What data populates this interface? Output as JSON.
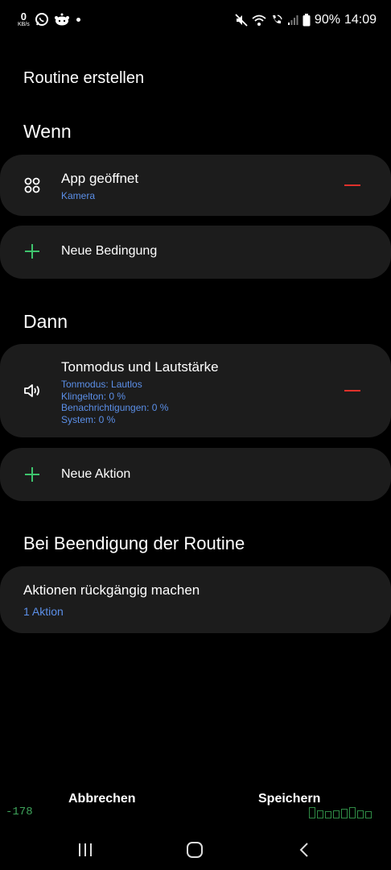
{
  "status_bar": {
    "net_speed_value": "0",
    "net_speed_unit": "KB/s",
    "battery": "90%",
    "time": "14:09"
  },
  "page_title": "Routine erstellen",
  "when": {
    "title": "Wenn",
    "condition": {
      "title": "App geöffnet",
      "subtitle": "Kamera",
      "icon": "apps-icon"
    },
    "add_label": "Neue Bedingung"
  },
  "then": {
    "title": "Dann",
    "action": {
      "title": "Tonmodus und Lautstärke",
      "details": [
        "Tonmodus: Lautlos",
        "Klingelton: 0 %",
        "Benachrichtigungen: 0 %",
        "System: 0 %"
      ],
      "icon": "speaker-icon"
    },
    "add_label": "Neue Aktion"
  },
  "on_end": {
    "title": "Bei Beendigung der Routine",
    "undo_title": "Aktionen rückgängig machen",
    "undo_subtitle": "1 Aktion"
  },
  "buttons": {
    "cancel": "Abbrechen",
    "save": "Speichern"
  },
  "overlay": {
    "number": "-178"
  },
  "colors": {
    "background": "#000000",
    "card": "#1c1c1c",
    "accent_blue": "#5b8fe8",
    "remove_red": "#e0312b",
    "add_green": "#3ec46d"
  }
}
